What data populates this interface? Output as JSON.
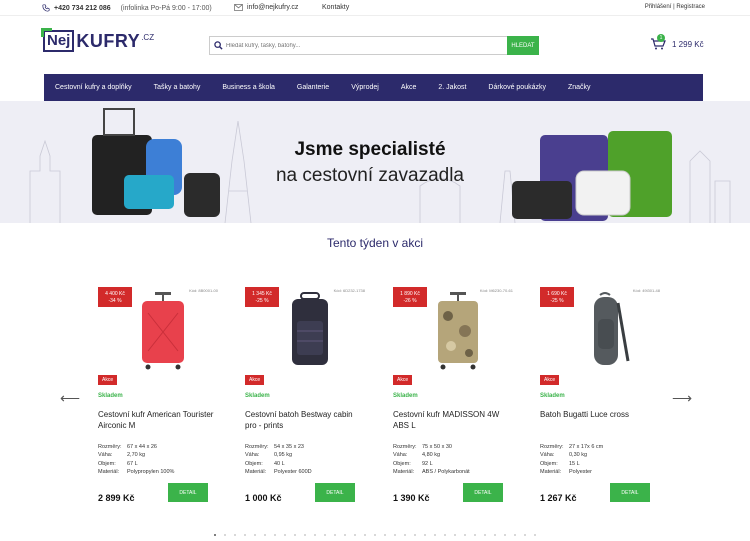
{
  "topbar": {
    "phone": "+420 734 212 086",
    "hours": "(infolinka Po-Pá 9:00 - 17:00)",
    "email": "info@nejkufry.cz",
    "contacts": "Kontakty",
    "login": "Přihlášení",
    "register": "Registrace"
  },
  "logo": {
    "nej": "Nej",
    "kufry": "KUFRY",
    "cz": ".CZ"
  },
  "search": {
    "placeholder": "Hledat kufry, tašky, batohy...",
    "button": "HLEDAT"
  },
  "cart": {
    "count": "1",
    "total": "1 299 Kč"
  },
  "nav": [
    "Cestovní kufry a doplňky",
    "Tašky a batohy",
    "Business a škola",
    "Galanterie",
    "Výprodej",
    "Akce",
    "2. Jakost",
    "Dárkové poukázky",
    "Značky"
  ],
  "banner": {
    "line1": "Jsme specialisté",
    "line2": "na cestovní zavazadla"
  },
  "section_title": "Tento týden v akci",
  "params_labels": {
    "rozmery": "Rozměry:",
    "vaha": "Váha:",
    "objem": "Objem:",
    "material": "Materiál:"
  },
  "products": [
    {
      "sale_old": "4 400 Kč",
      "sale_pct": "-34 %",
      "code": "Kód: 8B0001-00",
      "akce": "Akce",
      "stock": "Skladem",
      "name": "Cestovní kufr American Tourister Airconic M",
      "rozmery": "67 x 44 x 26",
      "vaha": "2,70 kg",
      "objem": "67 L",
      "material": "Polypropylen 100%",
      "price": "2 899 Kč",
      "detail": "DETAIL",
      "color": "#e8414c"
    },
    {
      "sale_old": "1 345 Kč",
      "sale_pct": "-25 %",
      "code": "Kód: 6D232-1738",
      "akce": "Akce",
      "stock": "Skladem",
      "name": "Cestovní batoh Bestway cabin pro - prints",
      "rozmery": "54 x 35 x 23",
      "vaha": "0,95 kg",
      "objem": "40 L",
      "material": "Polyester 600D",
      "price": "1 000 Kč",
      "detail": "DETAIL",
      "color": "#2f2f3d"
    },
    {
      "sale_old": "1 890 Kč",
      "sale_pct": "-26 %",
      "code": "Kód: M6230-70-61",
      "akce": "Akce",
      "stock": "Skladem",
      "name": "Cestovní kufr MADISSON 4W ABS L",
      "rozmery": "75 x 50 x 30",
      "vaha": "4,80 kg",
      "objem": "92 L",
      "material": "ABS / Polykarbonát",
      "price": "1 390 Kč",
      "detail": "DETAIL",
      "color": "#b5a57a"
    },
    {
      "sale_old": "1 690 Kč",
      "sale_pct": "-25 %",
      "code": "Kód: 49i301-48",
      "akce": "Akce",
      "stock": "Skladem",
      "name": "Batoh Bugatti Luce cross",
      "rozmery": "27 x 17x 6 cm",
      "vaha": "0,30 kg",
      "objem": "15 L",
      "material": "Polyester",
      "price": "1 267 Kč",
      "detail": "DETAIL",
      "color": "#555a5e"
    }
  ],
  "colors": {
    "brand": "#2c2a6b",
    "green": "#3bb34a",
    "red": "#d22a2a"
  }
}
